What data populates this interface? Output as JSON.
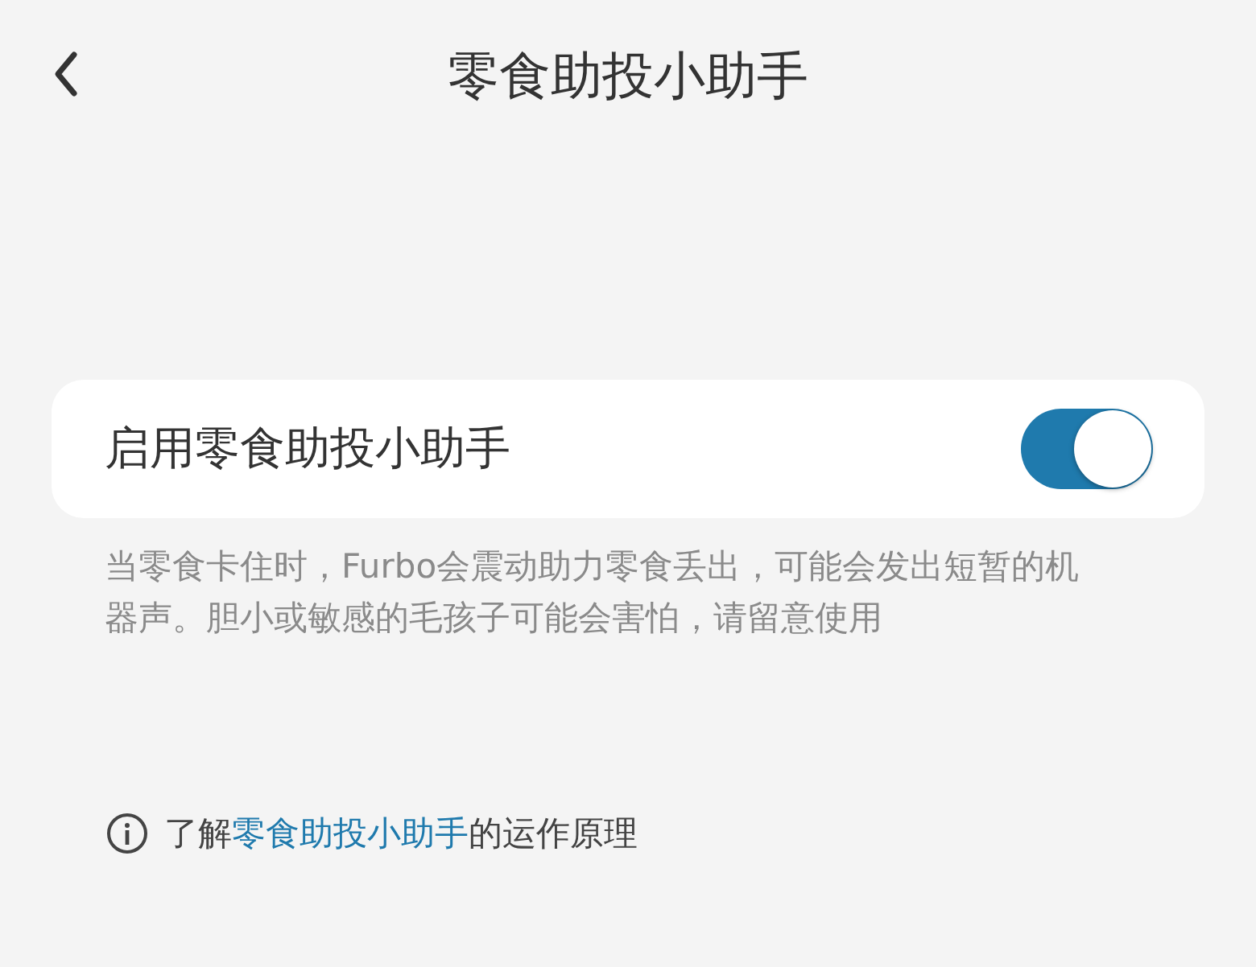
{
  "header": {
    "title": "零食助投小助手"
  },
  "setting": {
    "label": "启用零食助投小助手",
    "on": true
  },
  "description": "当零食卡住时，Furbo会震动助力零食丢出，可能会发出短暂的机器声。胆小或敏感的毛孩子可能会害怕，请留意使用",
  "info": {
    "before": "了解",
    "link": "零食助投小助手",
    "after": "的运作原理"
  }
}
